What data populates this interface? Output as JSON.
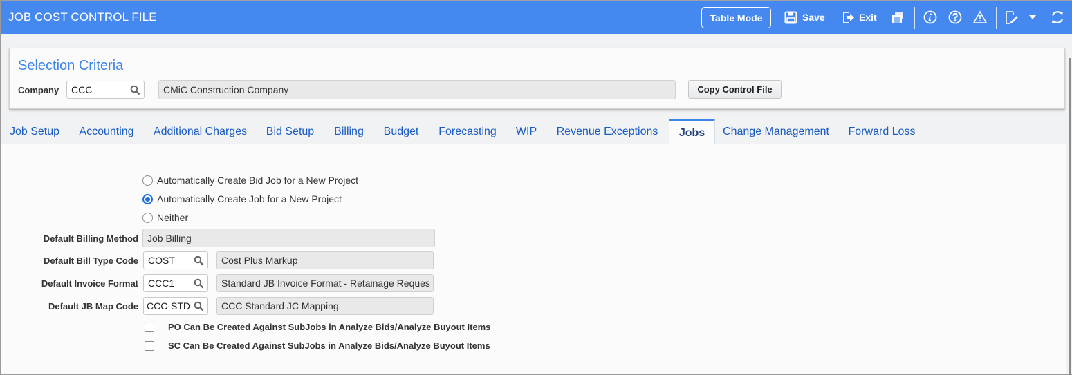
{
  "app": {
    "title": "JOB COST CONTROL FILE"
  },
  "toolbar": {
    "table_mode_label": "Table Mode",
    "save_label": "Save",
    "exit_label": "Exit",
    "icons": [
      "save-icon",
      "exit-icon",
      "print-icon",
      "info-icon",
      "help-icon",
      "warning-icon",
      "edit-icon",
      "chevron-down-icon",
      "refresh-icon"
    ]
  },
  "selection_criteria": {
    "title": "Selection Criteria",
    "company_label": "Company",
    "company_value": "CCC",
    "company_name": "CMiC Construction Company",
    "copy_button": "Copy Control File"
  },
  "tabs": [
    {
      "label": "Job Setup"
    },
    {
      "label": "Accounting"
    },
    {
      "label": "Additional Charges"
    },
    {
      "label": "Bid Setup"
    },
    {
      "label": "Billing"
    },
    {
      "label": "Budget"
    },
    {
      "label": "Forecasting"
    },
    {
      "label": "WIP"
    },
    {
      "label": "Revenue Exceptions"
    },
    {
      "label": "Jobs",
      "active": true
    },
    {
      "label": "Change Management"
    },
    {
      "label": "Forward Loss"
    }
  ],
  "jobs": {
    "radio_options": [
      {
        "label": "Automatically Create Bid Job for a New Project",
        "selected": false
      },
      {
        "label": "Automatically Create Job for a New Project",
        "selected": true
      },
      {
        "label": "Neither",
        "selected": false
      }
    ],
    "fields": {
      "billing_method": {
        "label": "Default Billing Method",
        "value": "Job Billing"
      },
      "bill_type_code": {
        "label": "Default Bill Type Code",
        "value": "COST",
        "description": "Cost Plus Markup"
      },
      "invoice_format": {
        "label": "Default Invoice Format",
        "value": "CCC1",
        "description": "Standard JB Invoice Format - Retainage Reques"
      },
      "jb_map_code": {
        "label": "Default JB Map Code",
        "value": "CCC-STD",
        "description": "CCC Standard JC Mapping"
      }
    },
    "checkboxes": [
      {
        "label": "PO Can Be Created Against SubJobs in Analyze Bids/Analyze Buyout Items",
        "checked": false
      },
      {
        "label": "SC Can Be Created Against SubJobs in Analyze Bids/Analyze Buyout Items",
        "checked": false
      }
    ]
  },
  "colors": {
    "header": "#4488f0",
    "accent": "#3f86e8",
    "tab_text": "#1a5bc4",
    "radio_selected": "#1a6fe0"
  }
}
